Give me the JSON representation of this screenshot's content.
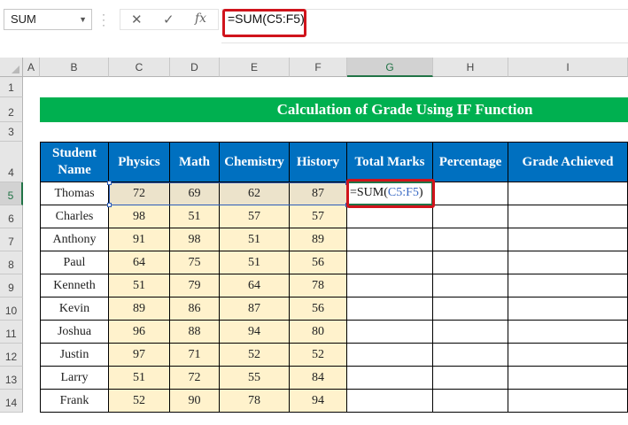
{
  "formula_bar": {
    "name_box": "SUM",
    "cancel_icon": "✕",
    "enter_icon": "✓",
    "fx_label": "fx",
    "formula": "=SUM(C5:F5)"
  },
  "columns": [
    "A",
    "B",
    "C",
    "D",
    "E",
    "F",
    "G",
    "H",
    "I"
  ],
  "selected_column": "G",
  "rows": [
    "1",
    "2",
    "3",
    "4",
    "5",
    "6",
    "7",
    "8",
    "9",
    "10",
    "11",
    "12",
    "13",
    "14"
  ],
  "selected_row": "5",
  "title": "Calculation of Grade Using IF Function",
  "table": {
    "headers": [
      "Student Name",
      "Physics",
      "Math",
      "Chemistry",
      "History",
      "Total Marks",
      "Percentage",
      "Grade Achieved"
    ],
    "rows": [
      [
        "Thomas",
        "72",
        "69",
        "62",
        "87"
      ],
      [
        "Charles",
        "98",
        "51",
        "57",
        "57"
      ],
      [
        "Anthony",
        "91",
        "98",
        "51",
        "89"
      ],
      [
        "Paul",
        "64",
        "75",
        "51",
        "56"
      ],
      [
        "Kenneth",
        "51",
        "79",
        "64",
        "78"
      ],
      [
        "Kevin",
        "89",
        "86",
        "87",
        "56"
      ],
      [
        "Joshua",
        "96",
        "88",
        "94",
        "80"
      ],
      [
        "Justin",
        "97",
        "71",
        "52",
        "52"
      ],
      [
        "Larry",
        "51",
        "72",
        "55",
        "84"
      ],
      [
        "Frank",
        "52",
        "90",
        "78",
        "94"
      ]
    ]
  },
  "edit_cell": {
    "prefix": "=SUM(",
    "ref": "C5:F5",
    "suffix": ")"
  },
  "colors": {
    "header_bg": "#0070c0",
    "title_bg": "#00b050",
    "data_bg": "#fff2cc",
    "highlight": "#d0141c"
  }
}
